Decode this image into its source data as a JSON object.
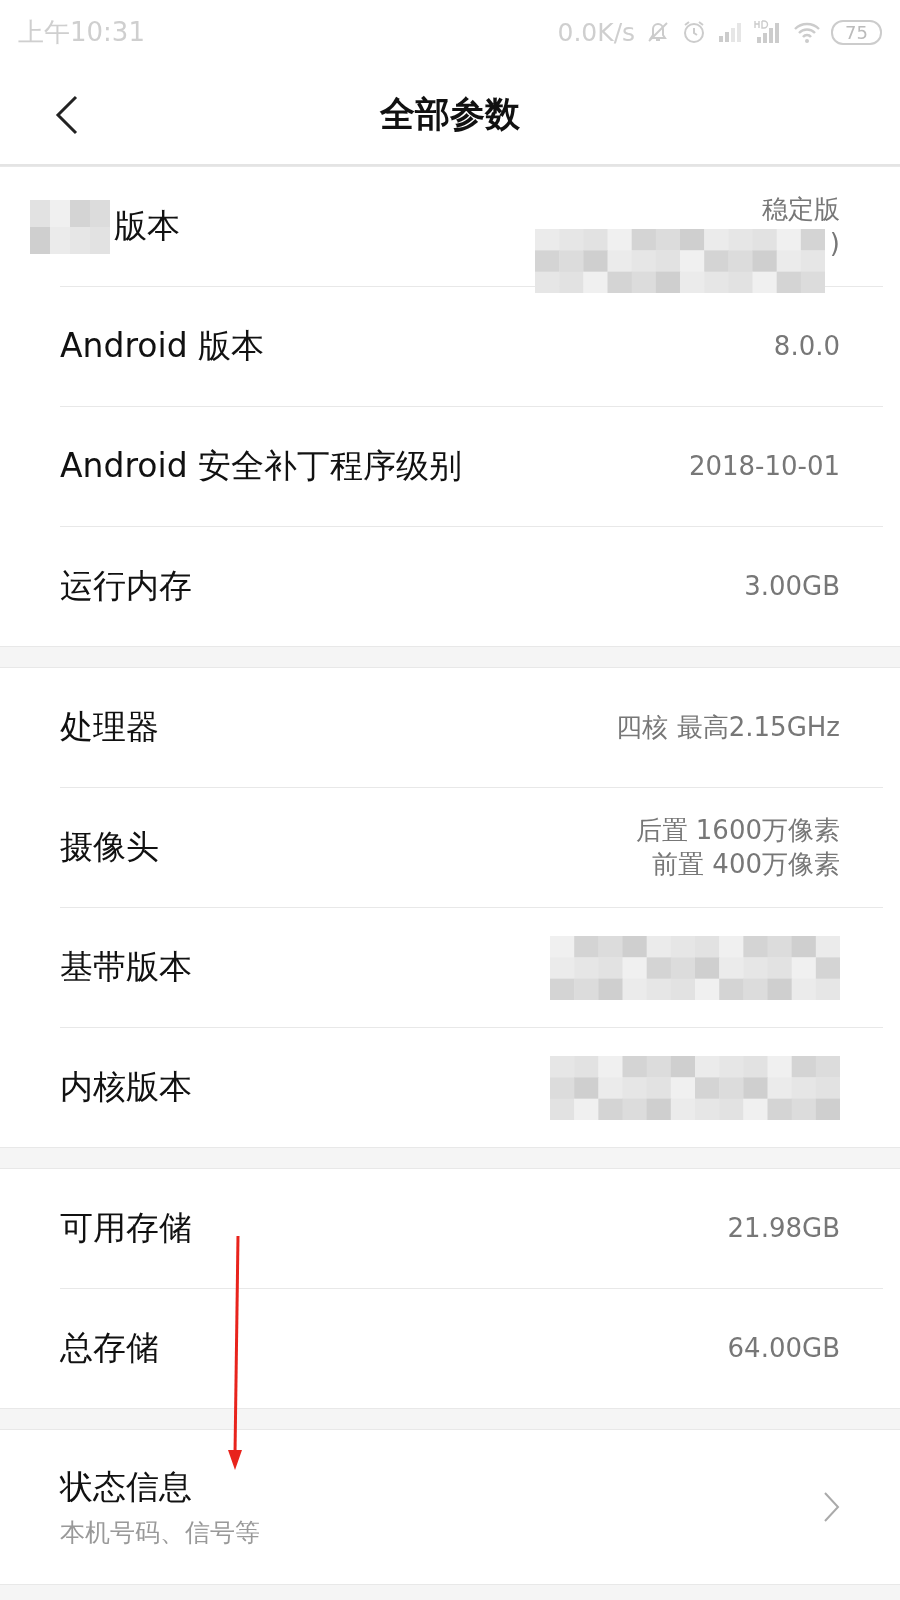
{
  "status_bar": {
    "time": "上午10:31",
    "speed": "0.0K/s",
    "battery": "75"
  },
  "header": {
    "title": "全部参数"
  },
  "sections": [
    {
      "rows": [
        {
          "label": "版本",
          "label_obscured": true,
          "values": [
            "稳定版",
            ")"
          ],
          "value_obscured": true
        },
        {
          "label": "Android 版本",
          "label_obscured": false,
          "values": [
            "8.0.0"
          ],
          "value_obscured": false
        },
        {
          "label": "Android 安全补丁程序级别",
          "label_obscured": false,
          "values": [
            "2018-10-01"
          ],
          "value_obscured": false
        },
        {
          "label": "运行内存",
          "label_obscured": false,
          "values": [
            "3.00GB"
          ],
          "value_obscured": false
        }
      ]
    },
    {
      "rows": [
        {
          "label": "处理器",
          "label_obscured": false,
          "values": [
            "四核 最高2.15GHz"
          ],
          "value_obscured": false
        },
        {
          "label": "摄像头",
          "label_obscured": false,
          "values": [
            "后置 1600万像素",
            "前置 400万像素"
          ],
          "value_obscured": false
        },
        {
          "label": "基带版本",
          "label_obscured": false,
          "values": [],
          "value_obscured": true
        },
        {
          "label": "内核版本",
          "label_obscured": false,
          "values": [],
          "value_obscured": true
        }
      ]
    },
    {
      "rows": [
        {
          "label": "可用存储",
          "label_obscured": false,
          "values": [
            "21.98GB"
          ],
          "value_obscured": false
        },
        {
          "label": "总存储",
          "label_obscured": false,
          "values": [
            "64.00GB"
          ],
          "value_obscured": false
        }
      ]
    },
    {
      "rows": [
        {
          "kind": "link",
          "label": "状态信息",
          "subtitle": "本机号码、信号等"
        }
      ]
    }
  ],
  "annotation_arrow": true
}
